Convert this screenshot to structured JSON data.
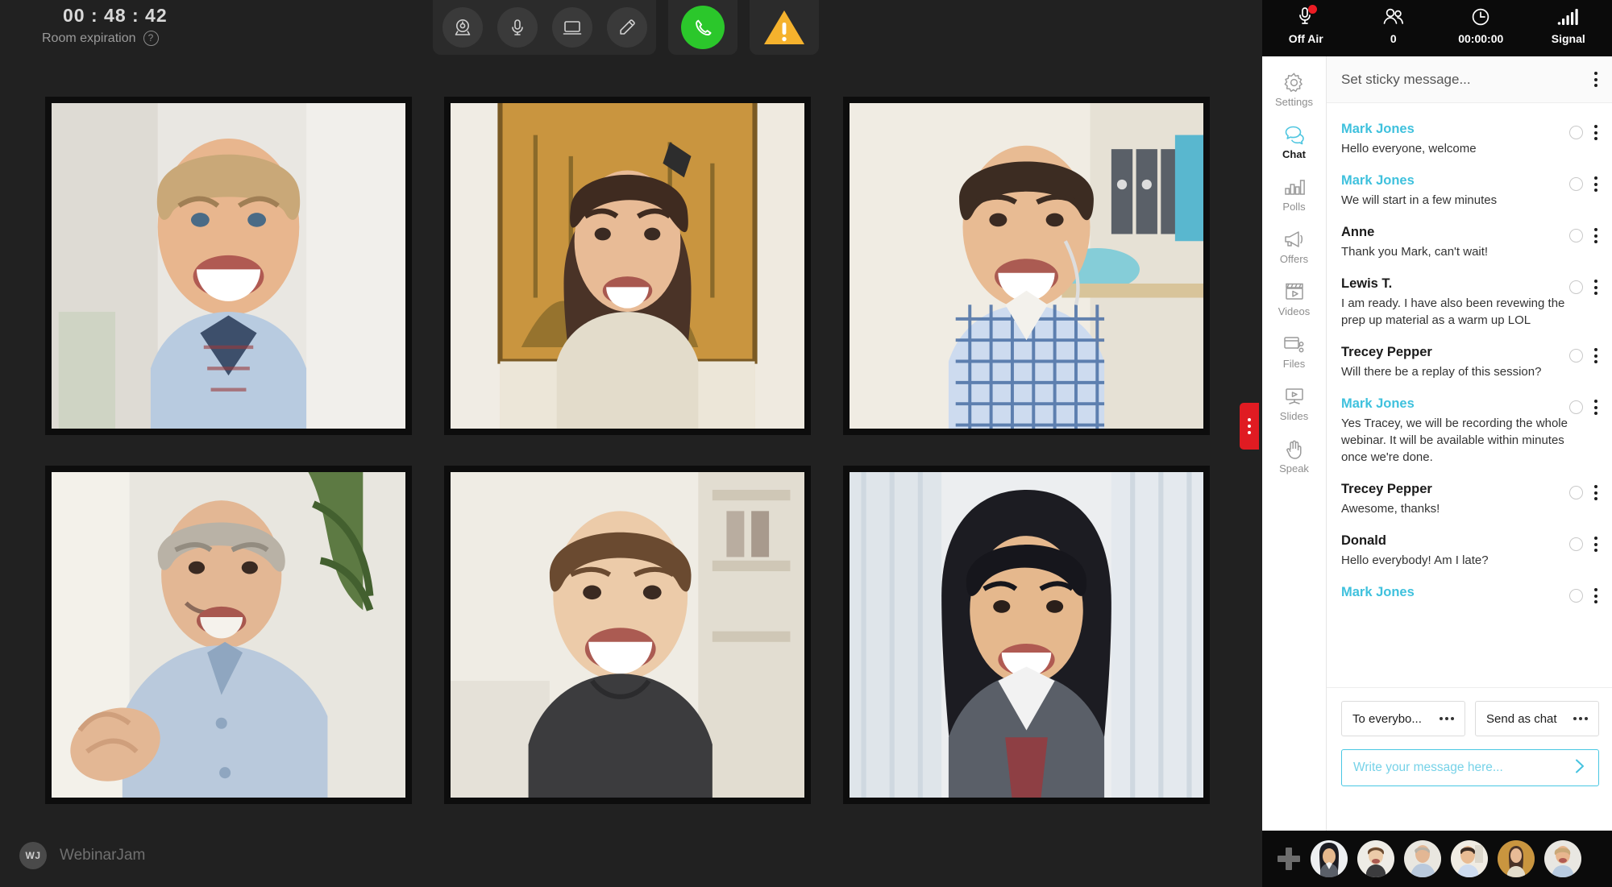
{
  "topbar": {
    "timer_value": "00 : 48 : 42",
    "timer_label": "Room expiration",
    "help_icon": "question-mark-icon",
    "tools": [
      {
        "name": "webcam-icon",
        "label": "Webcam"
      },
      {
        "name": "microphone-icon",
        "label": "Microphone"
      },
      {
        "name": "screen-share-icon",
        "label": "Share screen"
      },
      {
        "name": "whiteboard-pencil-icon",
        "label": "Draw"
      }
    ],
    "call_button": {
      "name": "phone-icon",
      "label": "Phone",
      "color": "#2bc72b"
    },
    "warning_button": {
      "name": "warning-triangle-icon",
      "label": "Warning",
      "color": "#f5b22d"
    }
  },
  "status": [
    {
      "icon": "microphone-recording-icon",
      "label": "Off Air"
    },
    {
      "icon": "attendees-icon",
      "label": "0"
    },
    {
      "icon": "clock-icon",
      "label": "00:00:00"
    },
    {
      "icon": "signal-bars-icon",
      "label": "Signal"
    }
  ],
  "nav": {
    "items": [
      {
        "icon": "gear-icon",
        "label": "Settings",
        "active": false
      },
      {
        "icon": "chat-bubbles-icon",
        "label": "Chat",
        "active": true
      },
      {
        "icon": "bar-chart-icon",
        "label": "Polls",
        "active": false
      },
      {
        "icon": "megaphone-icon",
        "label": "Offers",
        "active": false
      },
      {
        "icon": "film-clapper-icon",
        "label": "Videos",
        "active": false
      },
      {
        "icon": "files-share-icon",
        "label": "Files",
        "active": false
      },
      {
        "icon": "presentation-screen-icon",
        "label": "Slides",
        "active": false
      },
      {
        "icon": "raised-hand-icon",
        "label": "Speak",
        "active": false
      }
    ]
  },
  "chat": {
    "sticky_placeholder": "Set sticky message...",
    "messages": [
      {
        "author": "Mark Jones",
        "host": true,
        "text": "Hello everyone, welcome"
      },
      {
        "author": "Mark Jones",
        "host": true,
        "text": "We will start in a few minutes"
      },
      {
        "author": "Anne",
        "host": false,
        "text": "Thank you Mark, can't wait!"
      },
      {
        "author": "Lewis T.",
        "host": false,
        "text": "I am ready. I have also been revewing the prep up material as a warm up LOL"
      },
      {
        "author": "Trecey Pepper",
        "host": false,
        "text": "Will there be a replay of this session?"
      },
      {
        "author": "Mark Jones",
        "host": true,
        "text": "Yes Tracey, we will be recording the whole webinar. It will be available within minutes once we're done."
      },
      {
        "author": "Trecey Pepper",
        "host": false,
        "text": "Awesome, thanks!"
      },
      {
        "author": "Donald",
        "host": false,
        "text": "Hello everybody! Am I late?"
      },
      {
        "author": "Mark Jones",
        "host": true,
        "text": ""
      }
    ],
    "composer": {
      "recipient": "To everybo...",
      "mode": "Send as chat",
      "input_placeholder": "Write your message here...",
      "send_icon": "send-arrow-icon"
    }
  },
  "brand": {
    "logo_initials": "WJ",
    "name": "WebinarJam"
  },
  "collapse_handle": {
    "icon": "drag-dots-icon",
    "color": "#e01b22"
  },
  "stage": {
    "tiles": [
      {
        "name": "video-tile-1"
      },
      {
        "name": "video-tile-2"
      },
      {
        "name": "video-tile-3"
      },
      {
        "name": "video-tile-4"
      },
      {
        "name": "video-tile-5"
      },
      {
        "name": "video-tile-6"
      }
    ]
  },
  "avatars": {
    "add_label": "add-participant-icon",
    "count": 6
  }
}
